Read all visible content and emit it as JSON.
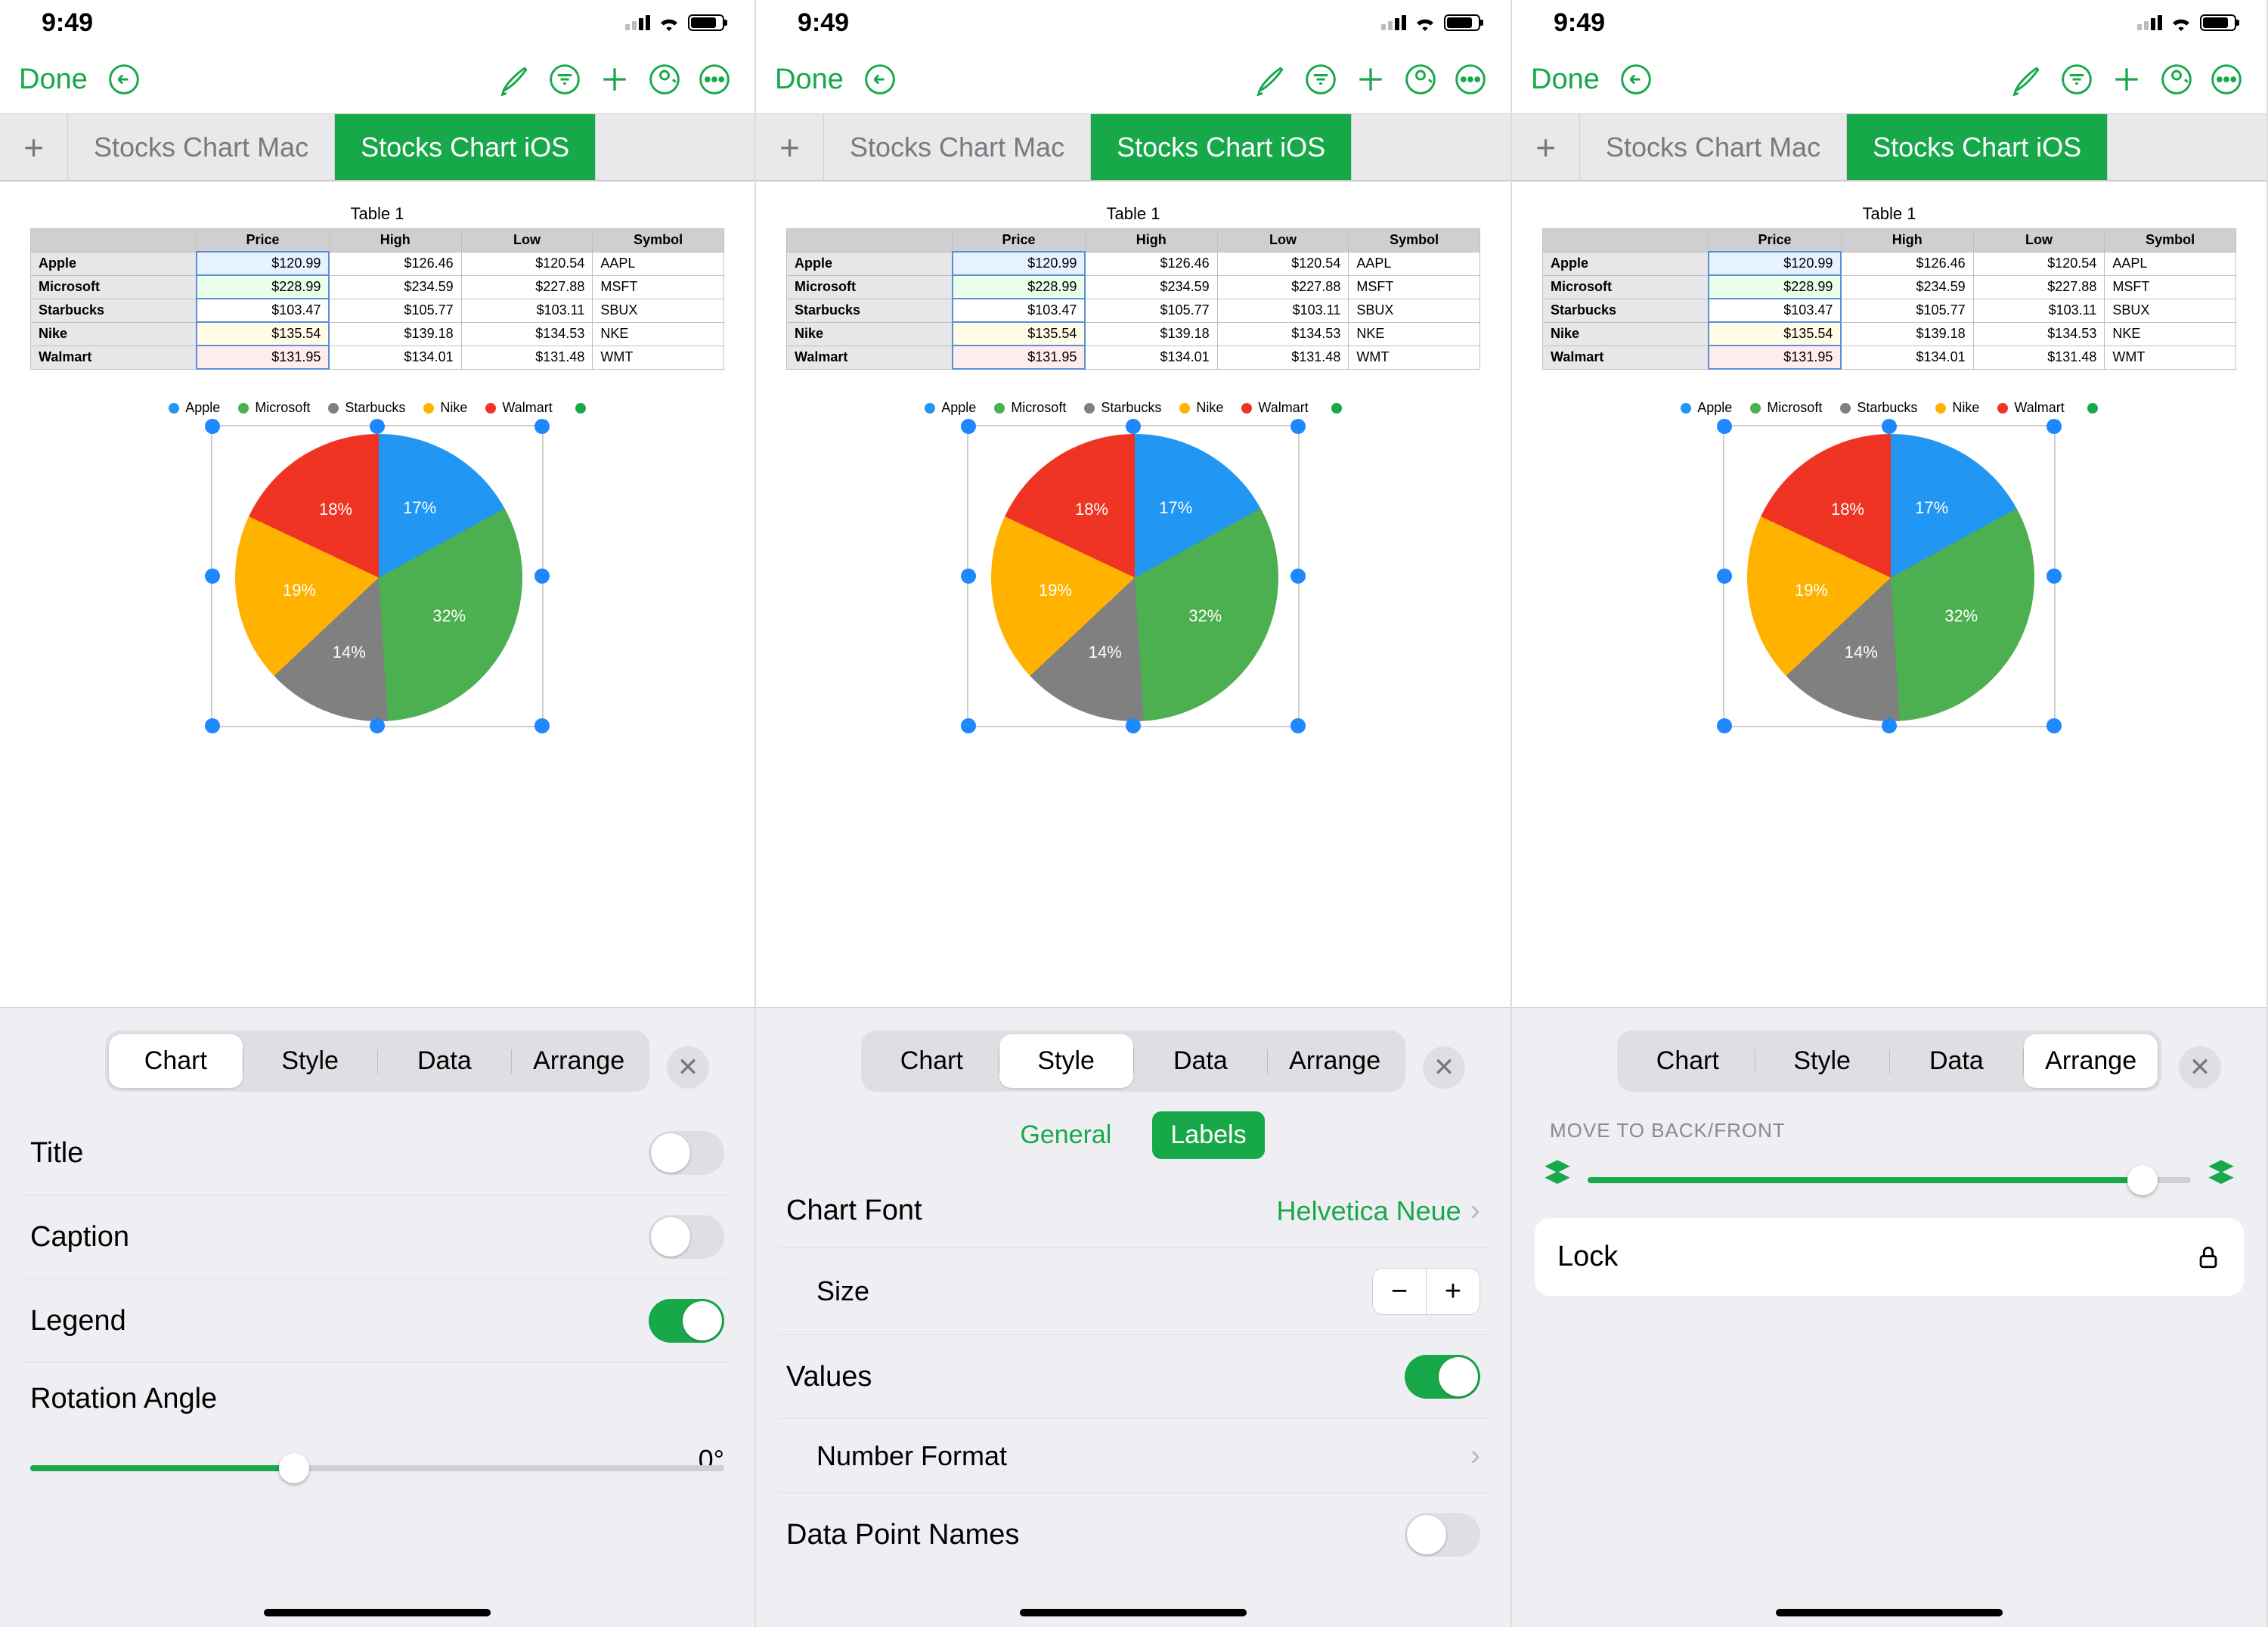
{
  "status": {
    "time": "9:49"
  },
  "toolbar": {
    "done": "Done"
  },
  "tabs": {
    "add": "+",
    "mac": "Stocks Chart Mac",
    "ios": "Stocks Chart iOS"
  },
  "table": {
    "title": "Table 1",
    "headers": [
      "",
      "Price",
      "High",
      "Low",
      "Symbol"
    ],
    "rows": [
      [
        "Apple",
        "$120.99",
        "$126.46",
        "$120.54",
        "AAPL"
      ],
      [
        "Microsoft",
        "$228.99",
        "$234.59",
        "$227.88",
        "MSFT"
      ],
      [
        "Starbucks",
        "$103.47",
        "$105.77",
        "$103.11",
        "SBUX"
      ],
      [
        "Nike",
        "$135.54",
        "$139.18",
        "$134.53",
        "NKE"
      ],
      [
        "Walmart",
        "$131.95",
        "$134.01",
        "$131.48",
        "WMT"
      ]
    ]
  },
  "legend": [
    "Apple",
    "Microsoft",
    "Starbucks",
    "Nike",
    "Walmart"
  ],
  "inspector": {
    "tabs": [
      "Chart",
      "Style",
      "Data",
      "Arrange"
    ],
    "chart": {
      "title": "Title",
      "caption": "Caption",
      "legend": "Legend",
      "rotation_label": "Rotation Angle",
      "rotation_value": "0°"
    },
    "style": {
      "subtabs": [
        "General",
        "Labels"
      ],
      "font_label": "Chart Font",
      "font_value": "Helvetica Neue",
      "size_label": "Size",
      "values_label": "Values",
      "number_format": "Number Format",
      "dpn": "Data Point Names"
    },
    "arrange": {
      "section": "MOVE TO BACK/FRONT",
      "lock": "Lock"
    }
  },
  "chart_data": {
    "type": "pie",
    "title": "",
    "series": [
      {
        "name": "Apple",
        "value": 17,
        "color": "#2196f3"
      },
      {
        "name": "Microsoft",
        "value": 32,
        "color": "#4caf50"
      },
      {
        "name": "Starbucks",
        "value": 14,
        "color": "#808080"
      },
      {
        "name": "Nike",
        "value": 19,
        "color": "#ffb300"
      },
      {
        "name": "Walmart",
        "value": 18,
        "color": "#f03424"
      }
    ],
    "labels_suffix": "%"
  }
}
